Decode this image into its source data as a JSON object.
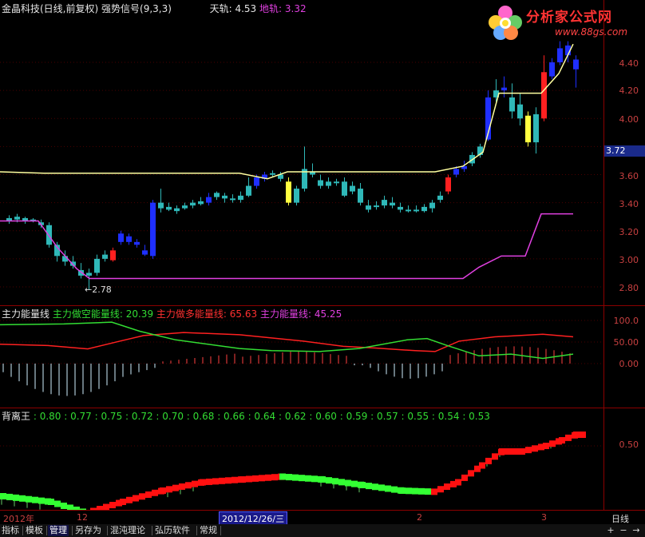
{
  "main_title": {
    "stock": "金晶科技(日线,前复权)",
    "indicator": "强势信号(9,3,3)",
    "upper_label": "天轨:",
    "upper_value": "4.53",
    "lower_label": "地轨:",
    "lower_value": "3.32"
  },
  "price_axis": [
    "4.40",
    "4.20",
    "4.00",
    "3.60",
    "3.40",
    "3.20",
    "3.00",
    "2.80"
  ],
  "current_price_tag": "3.72",
  "low_marker": "←2.78",
  "energy_title": {
    "name": "主力能量线",
    "short_label": "主力做空能量线:",
    "short_value": "20.39",
    "long_label": "主力做多能量线:",
    "long_value": "65.63",
    "energy_label": "主力能量线:",
    "energy_value": "45.25"
  },
  "energy_axis": [
    "100.0",
    "50.00",
    "0.00"
  ],
  "divergence_title": {
    "name": "背离王",
    "values": ": 0.80 : 0.77 : 0.75 : 0.72 : 0.70 : 0.68 : 0.66 : 0.64 : 0.62 : 0.60 : 0.59 : 0.57 : 0.55 : 0.54 : 0.53"
  },
  "divergence_axis": [
    "0.50"
  ],
  "date_bar": {
    "year": "2012年",
    "m12": "12",
    "selected": "2012/12/26/三",
    "m2": "2",
    "m3": "3",
    "period": "日线"
  },
  "tabs": [
    "指标",
    "模板",
    "管理",
    "另存为",
    "混沌理论",
    "弘历软件",
    "常规"
  ],
  "active_tab": "管理",
  "logo": {
    "name": "分析家公式网",
    "url": "www.88gs.com"
  },
  "controls": [
    "+",
    "−",
    "→"
  ],
  "colors": {
    "up_candle": "#2fb8b8",
    "down_candle_blue": "#1f2fff",
    "red": "#ff2020",
    "yellow": "#ffff40",
    "upper_band": "#ffffa0",
    "lower_band": "#e040e0",
    "divider": "#8b0000"
  }
}
